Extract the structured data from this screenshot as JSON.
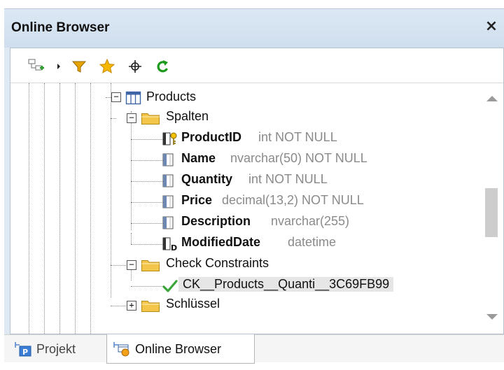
{
  "window": {
    "title": "Online Browser",
    "close_glyph": "×"
  },
  "toolbar": {
    "icons": [
      "add-connection-icon",
      "dropdown-arrow-icon",
      "filter-icon",
      "favorites-star-icon",
      "locate-crosshair-icon",
      "refresh-icon"
    ]
  },
  "tree": {
    "table": {
      "label": "Products",
      "toggle": "−"
    },
    "columns_folder": {
      "label": "Spalten",
      "toggle": "−"
    },
    "columns": [
      {
        "name": "ProductID",
        "type": "int NOT NULL",
        "icon": "primary-key-column-icon"
      },
      {
        "name": "Name",
        "type": "nvarchar(50) NOT NULL",
        "icon": "column-icon"
      },
      {
        "name": "Quantity",
        "type": "int NOT NULL",
        "icon": "column-icon"
      },
      {
        "name": "Price",
        "type": "decimal(13,2) NOT NULL",
        "icon": "column-icon"
      },
      {
        "name": "Description",
        "type": "nvarchar(255)",
        "icon": "column-icon"
      },
      {
        "name": "ModifiedDate",
        "type": "datetime",
        "icon": "default-column-icon"
      }
    ],
    "check_folder": {
      "label": "Check Constraints",
      "toggle": "−"
    },
    "check_constraint": {
      "label": "CK__Products__Quanti__3C69FB99"
    },
    "keys_folder": {
      "label": "Schlüssel",
      "toggle": "+"
    }
  },
  "tabs": [
    {
      "label": "Projekt",
      "active": false
    },
    {
      "label": "Online Browser",
      "active": true
    }
  ],
  "colors": {
    "title_bar": "#cfdeee",
    "folder": "#f3c64a",
    "check": "#3aa63a",
    "refresh": "#1a9a1a",
    "filter": "#e5a300",
    "star": "#f5b800",
    "column_icon": "#6c88b0"
  }
}
